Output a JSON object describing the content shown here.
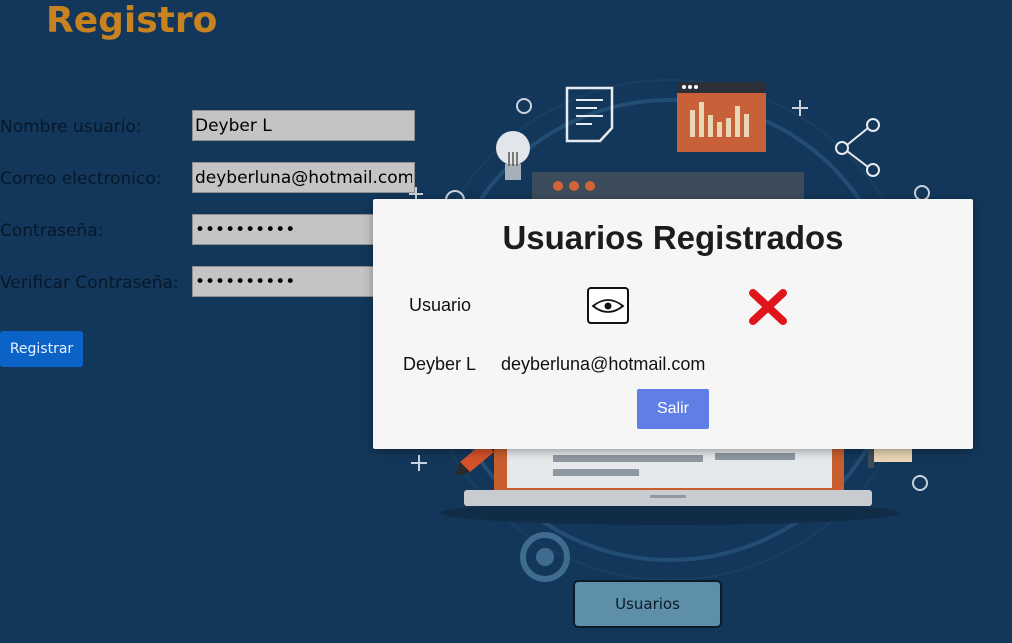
{
  "page": {
    "title": "Registro"
  },
  "form": {
    "username_label": "Nombre usuario:",
    "username_value": "Deyber L",
    "email_label": "Correo electronico:",
    "email_value": "deyberluna@hotmail.com",
    "password_label": "Contraseña:",
    "password_value": "••••••••••",
    "verify_label": "Verificar Contraseña:",
    "verify_value": "••••••••••",
    "register_label": "Registrar"
  },
  "modal": {
    "title": "Usuarios Registrados",
    "header_user": "Usuario",
    "view_icon": "eye-icon",
    "delete_icon": "red-x-icon",
    "rows": [
      {
        "name": "Deyber L",
        "email": "deyberluna@hotmail.com"
      }
    ],
    "exit_label": "Salir"
  },
  "footer": {
    "users_button_label": "Usuarios"
  },
  "colors": {
    "background": "#13375a",
    "title": "#c8821f",
    "register_button": "#0b63c7",
    "exit_button": "#5f7fe6",
    "users_button": "#5e8fa8",
    "delete_icon": "#e0141b"
  }
}
